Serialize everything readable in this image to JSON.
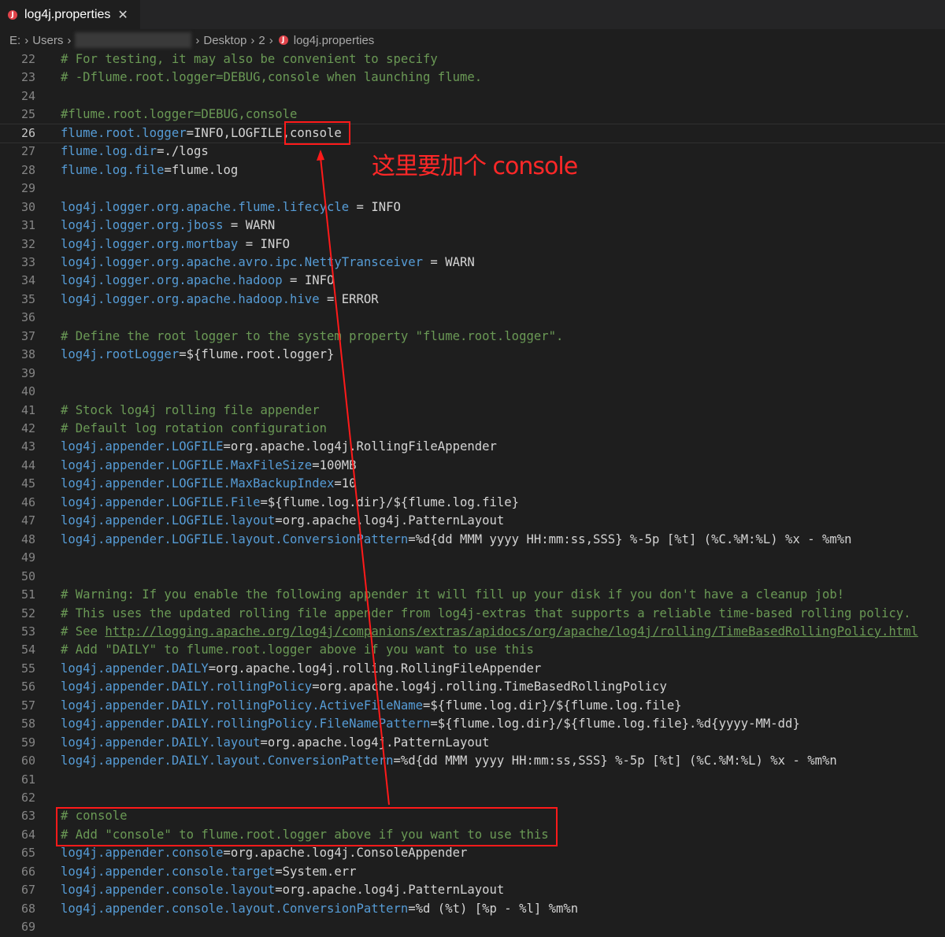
{
  "tab": {
    "title": "log4j.properties",
    "close_glyph": "✕",
    "icon_glyph": "J"
  },
  "breadcrumb": {
    "drive": "E:",
    "users": "Users",
    "desktop": "Desktop",
    "folder": "2",
    "file": "log4j.properties",
    "sep": "›"
  },
  "annotation": {
    "note": "这里要加个 console"
  },
  "lines": [
    {
      "n": "22",
      "parts": [
        {
          "t": "c",
          "s": "# For testing, it may also be convenient to specify"
        }
      ]
    },
    {
      "n": "23",
      "parts": [
        {
          "t": "c",
          "s": "# -Dflume.root.logger=DEBUG,console when launching flume."
        }
      ]
    },
    {
      "n": "24",
      "parts": []
    },
    {
      "n": "25",
      "parts": [
        {
          "t": "c",
          "s": "#flume.root.logger=DEBUG,console"
        }
      ]
    },
    {
      "n": "26",
      "current": true,
      "parts": [
        {
          "t": "k",
          "s": "flume.root.logger"
        },
        {
          "t": "v",
          "s": "=INFO,LOGFILE,console"
        }
      ]
    },
    {
      "n": "27",
      "parts": [
        {
          "t": "k",
          "s": "flume.log.dir"
        },
        {
          "t": "v",
          "s": "=./logs"
        }
      ]
    },
    {
      "n": "28",
      "parts": [
        {
          "t": "k",
          "s": "flume.log.file"
        },
        {
          "t": "v",
          "s": "=flume.log"
        }
      ]
    },
    {
      "n": "29",
      "parts": []
    },
    {
      "n": "30",
      "parts": [
        {
          "t": "k",
          "s": "log4j.logger.org.apache.flume.lifecycle"
        },
        {
          "t": "v",
          "s": " = INFO"
        }
      ]
    },
    {
      "n": "31",
      "parts": [
        {
          "t": "k",
          "s": "log4j.logger.org.jboss"
        },
        {
          "t": "v",
          "s": " = WARN"
        }
      ]
    },
    {
      "n": "32",
      "parts": [
        {
          "t": "k",
          "s": "log4j.logger.org.mortbay"
        },
        {
          "t": "v",
          "s": " = INFO"
        }
      ]
    },
    {
      "n": "33",
      "parts": [
        {
          "t": "k",
          "s": "log4j.logger.org.apache.avro.ipc.NettyTransceiver"
        },
        {
          "t": "v",
          "s": " = WARN"
        }
      ]
    },
    {
      "n": "34",
      "parts": [
        {
          "t": "k",
          "s": "log4j.logger.org.apache.hadoop"
        },
        {
          "t": "v",
          "s": " = INFO"
        }
      ]
    },
    {
      "n": "35",
      "parts": [
        {
          "t": "k",
          "s": "log4j.logger.org.apache.hadoop.hive"
        },
        {
          "t": "v",
          "s": " = ERROR"
        }
      ]
    },
    {
      "n": "36",
      "parts": []
    },
    {
      "n": "37",
      "parts": [
        {
          "t": "c",
          "s": "# Define the root logger to the system property \"flume.root.logger\"."
        }
      ]
    },
    {
      "n": "38",
      "parts": [
        {
          "t": "k",
          "s": "log4j.rootLogger"
        },
        {
          "t": "v",
          "s": "=${flume.root.logger}"
        }
      ]
    },
    {
      "n": "39",
      "parts": []
    },
    {
      "n": "40",
      "parts": []
    },
    {
      "n": "41",
      "parts": [
        {
          "t": "c",
          "s": "# Stock log4j rolling file appender"
        }
      ]
    },
    {
      "n": "42",
      "parts": [
        {
          "t": "c",
          "s": "# Default log rotation configuration"
        }
      ]
    },
    {
      "n": "43",
      "parts": [
        {
          "t": "k",
          "s": "log4j.appender.LOGFILE"
        },
        {
          "t": "v",
          "s": "=org.apache.log4j.RollingFileAppender"
        }
      ]
    },
    {
      "n": "44",
      "parts": [
        {
          "t": "k",
          "s": "log4j.appender.LOGFILE.MaxFileSize"
        },
        {
          "t": "v",
          "s": "=100MB"
        }
      ]
    },
    {
      "n": "45",
      "parts": [
        {
          "t": "k",
          "s": "log4j.appender.LOGFILE.MaxBackupIndex"
        },
        {
          "t": "v",
          "s": "=10"
        }
      ]
    },
    {
      "n": "46",
      "parts": [
        {
          "t": "k",
          "s": "log4j.appender.LOGFILE.File"
        },
        {
          "t": "v",
          "s": "=${flume.log.dir}/${flume.log.file}"
        }
      ]
    },
    {
      "n": "47",
      "parts": [
        {
          "t": "k",
          "s": "log4j.appender.LOGFILE.layout"
        },
        {
          "t": "v",
          "s": "=org.apache.log4j.PatternLayout"
        }
      ]
    },
    {
      "n": "48",
      "parts": [
        {
          "t": "k",
          "s": "log4j.appender.LOGFILE.layout.ConversionPattern"
        },
        {
          "t": "v",
          "s": "=%d{dd MMM yyyy HH:mm:ss,SSS} %-5p [%t] (%C.%M:%L) %x - %m%n"
        }
      ]
    },
    {
      "n": "49",
      "parts": []
    },
    {
      "n": "50",
      "parts": []
    },
    {
      "n": "51",
      "parts": [
        {
          "t": "c",
          "s": "# Warning: If you enable the following appender it will fill up your disk if you don't have a cleanup job!"
        }
      ]
    },
    {
      "n": "52",
      "parts": [
        {
          "t": "c",
          "s": "# This uses the updated rolling file appender from log4j-extras that supports a reliable time-based rolling policy."
        }
      ]
    },
    {
      "n": "53",
      "parts": [
        {
          "t": "c",
          "s": "# See "
        },
        {
          "t": "l",
          "s": "http://logging.apache.org/log4j/companions/extras/apidocs/org/apache/log4j/rolling/TimeBasedRollingPolicy.html"
        }
      ]
    },
    {
      "n": "54",
      "parts": [
        {
          "t": "c",
          "s": "# Add \"DAILY\" to flume.root.logger above if you want to use this"
        }
      ]
    },
    {
      "n": "55",
      "parts": [
        {
          "t": "k",
          "s": "log4j.appender.DAILY"
        },
        {
          "t": "v",
          "s": "=org.apache.log4j.rolling.RollingFileAppender"
        }
      ]
    },
    {
      "n": "56",
      "parts": [
        {
          "t": "k",
          "s": "log4j.appender.DAILY.rollingPolicy"
        },
        {
          "t": "v",
          "s": "=org.apache.log4j.rolling.TimeBasedRollingPolicy"
        }
      ]
    },
    {
      "n": "57",
      "parts": [
        {
          "t": "k",
          "s": "log4j.appender.DAILY.rollingPolicy.ActiveFileName"
        },
        {
          "t": "v",
          "s": "=${flume.log.dir}/${flume.log.file}"
        }
      ]
    },
    {
      "n": "58",
      "parts": [
        {
          "t": "k",
          "s": "log4j.appender.DAILY.rollingPolicy.FileNamePattern"
        },
        {
          "t": "v",
          "s": "=${flume.log.dir}/${flume.log.file}.%d{yyyy-MM-dd}"
        }
      ]
    },
    {
      "n": "59",
      "parts": [
        {
          "t": "k",
          "s": "log4j.appender.DAILY.layout"
        },
        {
          "t": "v",
          "s": "=org.apache.log4j.PatternLayout"
        }
      ]
    },
    {
      "n": "60",
      "parts": [
        {
          "t": "k",
          "s": "log4j.appender.DAILY.layout.ConversionPattern"
        },
        {
          "t": "v",
          "s": "=%d{dd MMM yyyy HH:mm:ss,SSS} %-5p [%t] (%C.%M:%L) %x - %m%n"
        }
      ]
    },
    {
      "n": "61",
      "parts": []
    },
    {
      "n": "62",
      "parts": []
    },
    {
      "n": "63",
      "parts": [
        {
          "t": "c",
          "s": "# console"
        }
      ]
    },
    {
      "n": "64",
      "parts": [
        {
          "t": "c",
          "s": "# Add \"console\" to flume.root.logger above if you want to use this"
        }
      ]
    },
    {
      "n": "65",
      "parts": [
        {
          "t": "k",
          "s": "log4j.appender.console"
        },
        {
          "t": "v",
          "s": "=org.apache.log4j.ConsoleAppender"
        }
      ]
    },
    {
      "n": "66",
      "parts": [
        {
          "t": "k",
          "s": "log4j.appender.console.target"
        },
        {
          "t": "v",
          "s": "=System.err"
        }
      ]
    },
    {
      "n": "67",
      "parts": [
        {
          "t": "k",
          "s": "log4j.appender.console.layout"
        },
        {
          "t": "v",
          "s": "=org.apache.log4j.PatternLayout"
        }
      ]
    },
    {
      "n": "68",
      "parts": [
        {
          "t": "k",
          "s": "log4j.appender.console.layout.ConversionPattern"
        },
        {
          "t": "v",
          "s": "=%d (%t) [%p - %l] %m%n"
        }
      ]
    },
    {
      "n": "69",
      "parts": []
    }
  ]
}
